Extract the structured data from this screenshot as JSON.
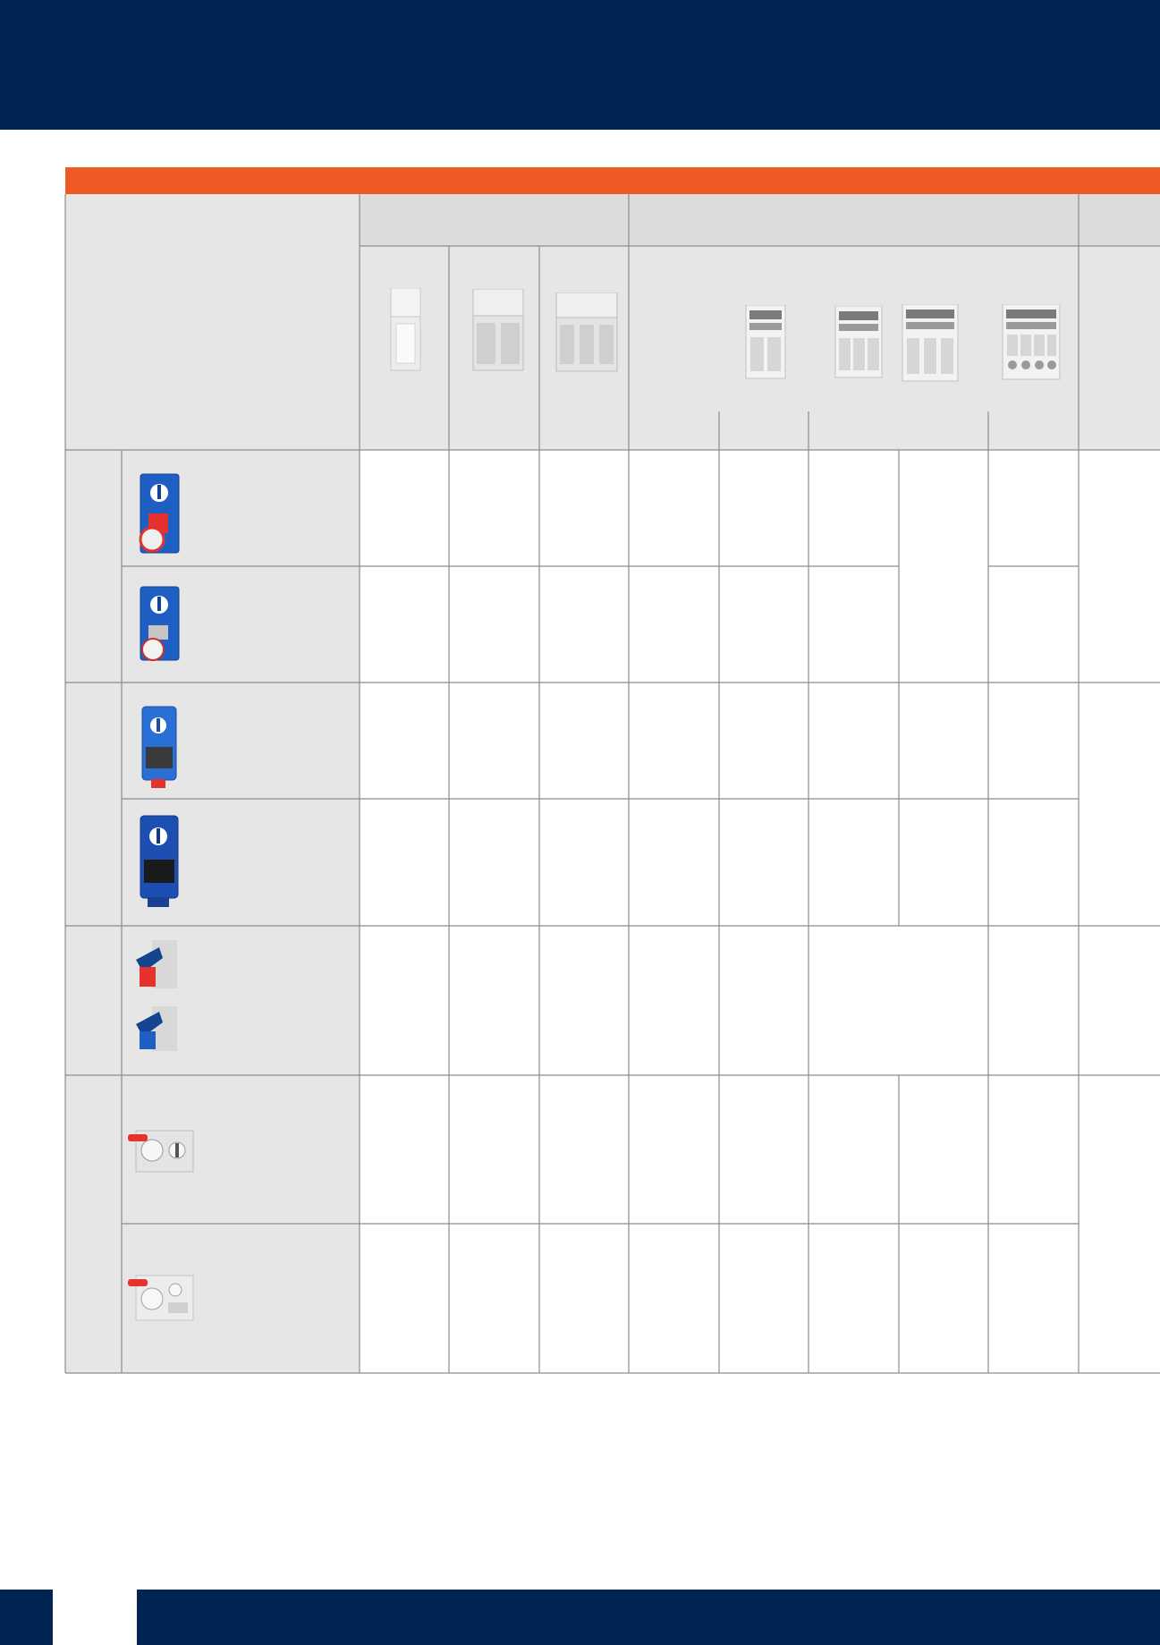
{
  "colors": {
    "navy": "#002552",
    "orange": "#ee5a24",
    "cell_grey": "#e6e6e6",
    "header_grey": "#dcdcdc",
    "grid_line": "#8c8c8c"
  },
  "header_columns": [
    {
      "group": "wall-mount-enclosures",
      "icon": "single-enclosure-icon"
    },
    {
      "group": "wall-mount-enclosures",
      "icon": "double-enclosure-icon"
    },
    {
      "group": "wall-mount-enclosures",
      "icon": "triple-enclosure-icon"
    },
    {
      "group": "distribution-boards",
      "icon": "empty-column"
    },
    {
      "group": "distribution-boards",
      "icon": "board-2-socket-icon"
    },
    {
      "group": "distribution-boards",
      "icon": "board-3-socket-icon"
    },
    {
      "group": "distribution-boards",
      "icon": "board-3-socket-wide-icon"
    },
    {
      "group": "distribution-boards",
      "icon": "board-multi-socket-icon"
    }
  ],
  "row_products": [
    {
      "icon": "interlocked-socket-red-large-icon"
    },
    {
      "icon": "interlocked-socket-red-small-icon"
    },
    {
      "icon": "interlocked-socket-blue-icon"
    },
    {
      "icon": "interlocked-socket-blue-large-icon"
    },
    {
      "icon": "angled-socket-pair-icon"
    },
    {
      "icon": "modular-socket-red-icon"
    },
    {
      "icon": "modular-socket-grey-icon"
    }
  ]
}
